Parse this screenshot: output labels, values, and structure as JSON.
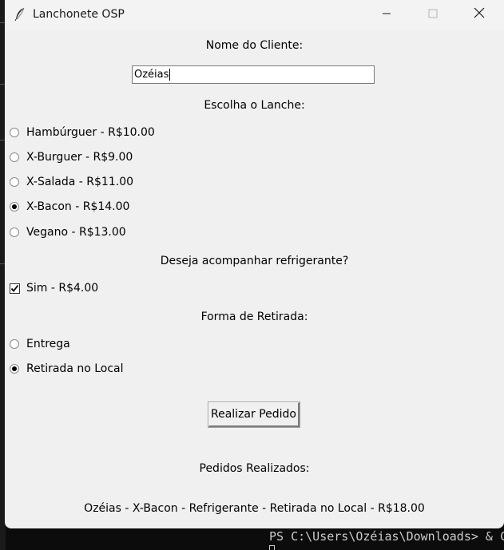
{
  "window": {
    "title": "Lanchonete OSP",
    "controls": {
      "minimize": "minimize-icon",
      "maximize": "maximize-icon",
      "close": "close-icon"
    }
  },
  "form": {
    "name_label": "Nome do Cliente:",
    "name_value": "Ozéias",
    "lanche_label": "Escolha o Lanche:",
    "lanches": [
      {
        "label": "Hambúrguer - R$10.00",
        "selected": false
      },
      {
        "label": "X-Burguer - R$9.00",
        "selected": false
      },
      {
        "label": "X-Salada - R$11.00",
        "selected": false
      },
      {
        "label": "X-Bacon - R$14.00",
        "selected": true
      },
      {
        "label": "Vegano - R$13.00",
        "selected": false
      }
    ],
    "refri_label": "Deseja acompanhar refrigerante?",
    "refri_option": {
      "label": "Sim - R$4.00",
      "checked": true
    },
    "retirada_label": "Forma de Retirada:",
    "retiradas": [
      {
        "label": "Entrega",
        "selected": false
      },
      {
        "label": "Retirada no Local",
        "selected": true
      }
    ],
    "submit_label": "Realizar Pedido",
    "orders_label": "Pedidos Realizados:",
    "orders": [
      "Ozéias - X-Bacon - Refrigerante - Retirada no Local - R$18.00"
    ]
  },
  "terminal": {
    "prompt": "PS C:\\Users\\Ozéias\\Downloads> & C"
  }
}
